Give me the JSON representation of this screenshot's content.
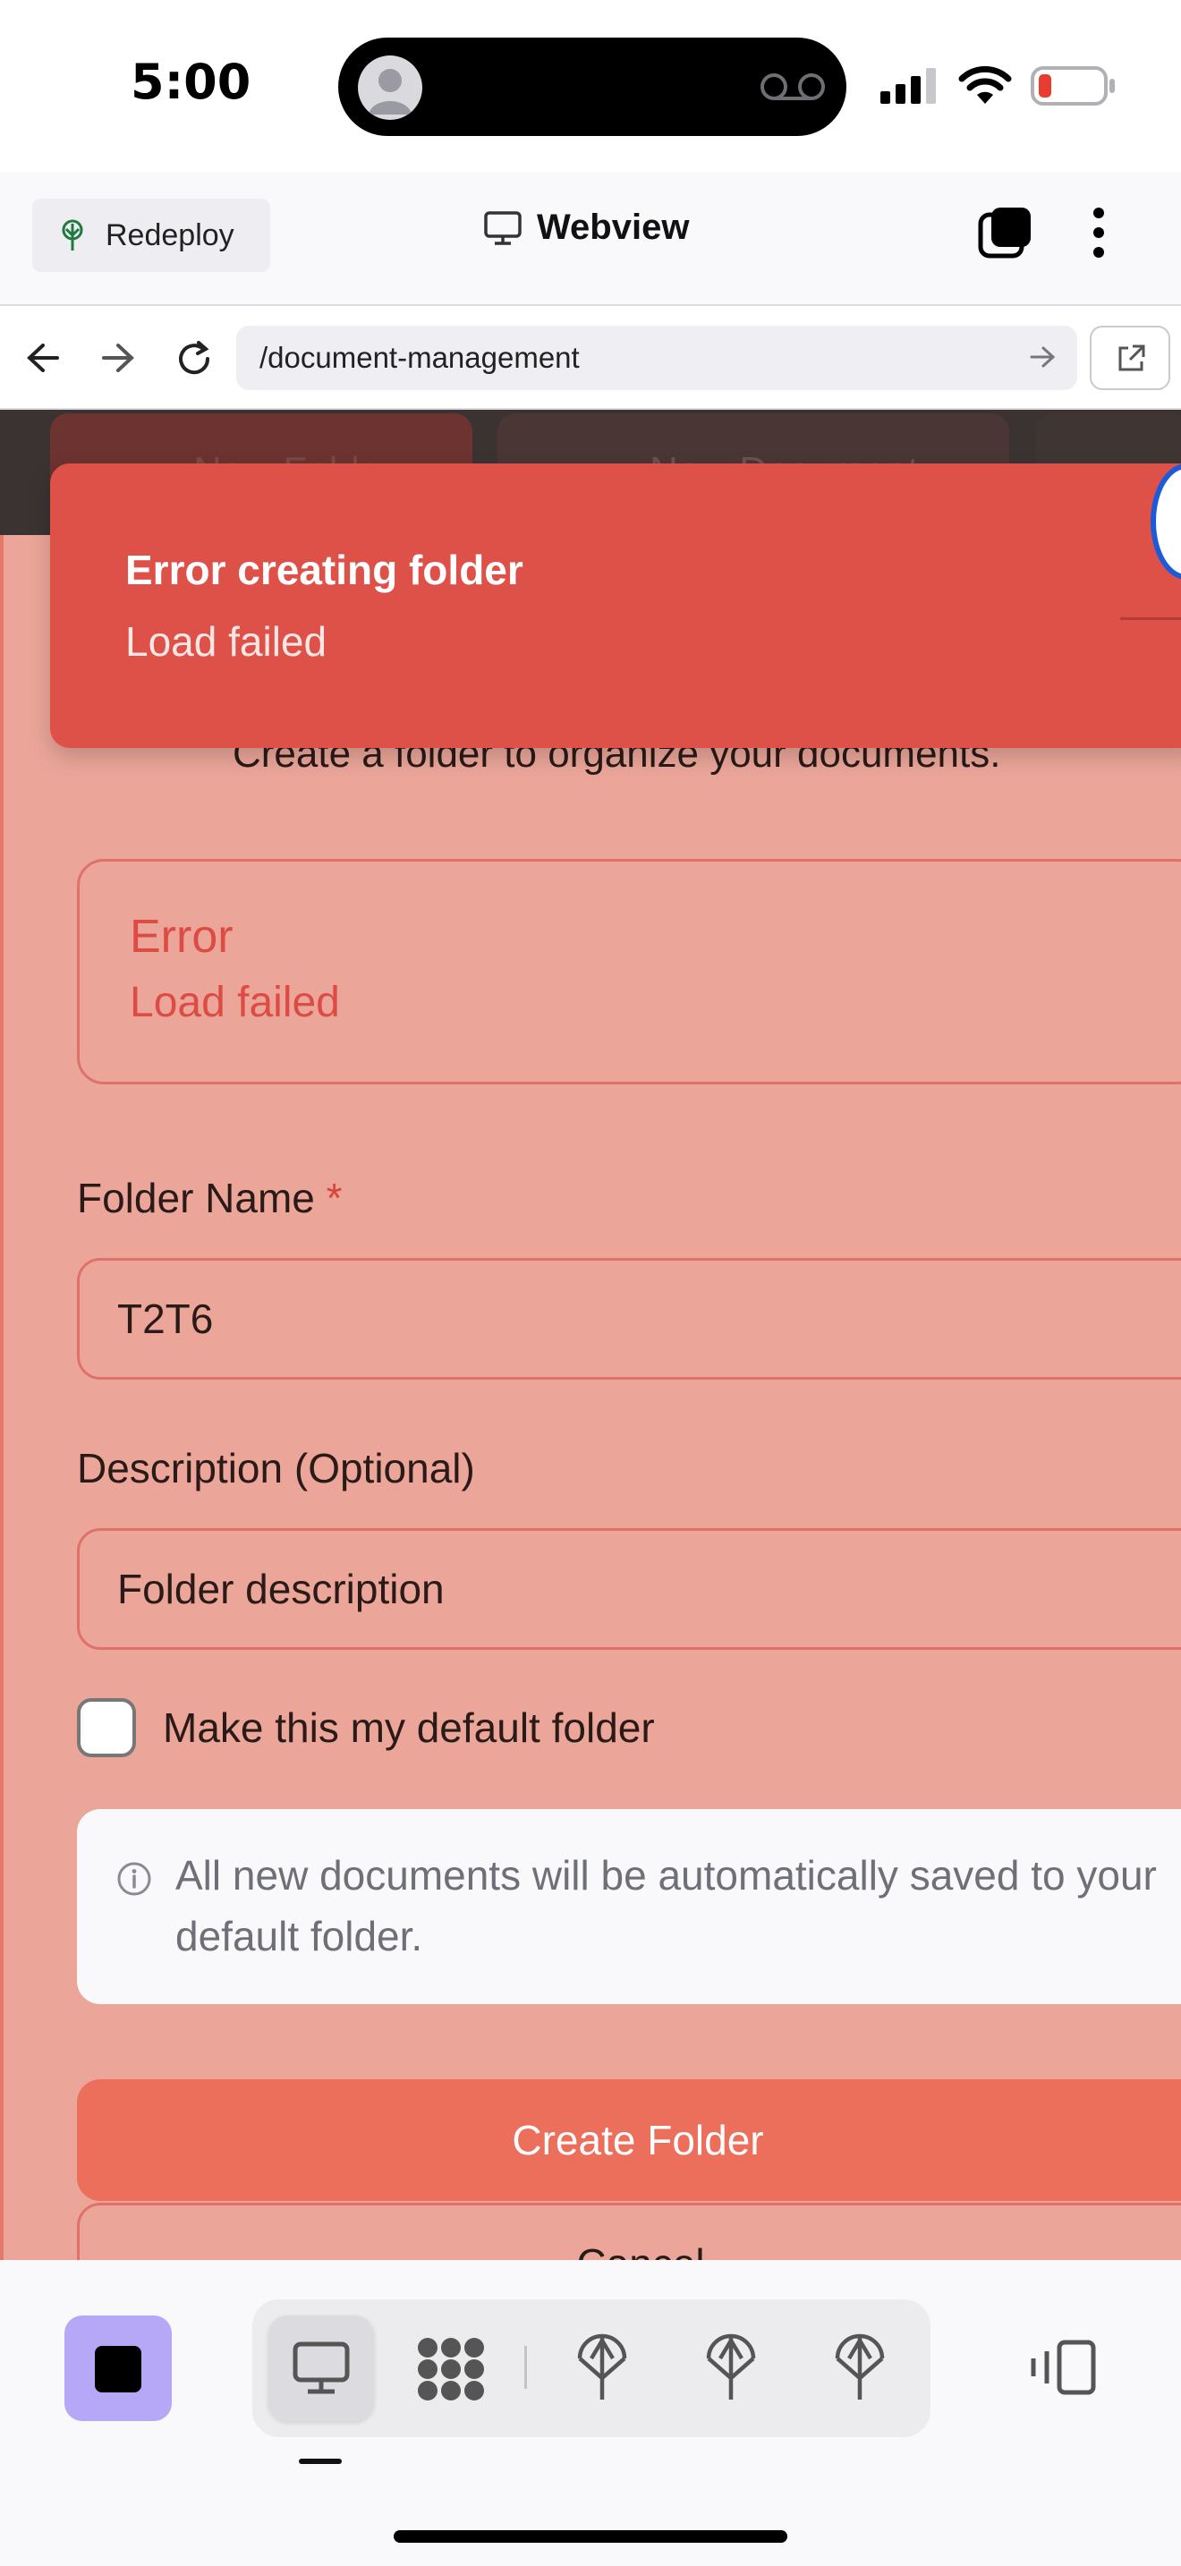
{
  "status_bar": {
    "time": "5:00"
  },
  "header": {
    "redeploy_label": "Redeploy",
    "title": "Webview"
  },
  "address_bar": {
    "url": "/document-management"
  },
  "page": {
    "toolbar_buttons": [
      "New Folder",
      "New Document"
    ],
    "subtitle": "Create a folder to organize your documents."
  },
  "toast": {
    "title": "Error creating folder",
    "message": "Load failed"
  },
  "form": {
    "error_title": "Error",
    "error_message": "Load failed",
    "folder_name_label": "Folder Name",
    "required_mark": "*",
    "folder_name_value": "T2T6",
    "description_label": "Description (Optional)",
    "description_placeholder": "Folder description",
    "default_checkbox_label": "Make this my default folder",
    "default_checked": false,
    "info_text": "All new documents will be automatically saved to your default folder.",
    "create_label": "Create Folder",
    "cancel_label": "Cancel"
  },
  "colors": {
    "toast_bg": "#dd5149",
    "error_text": "#dd4b45",
    "primary_button": "#ec6f5c",
    "app_icon_bg": "#b7a7f7"
  },
  "icons": {
    "header": [
      "tree-icon",
      "monitor-icon",
      "tabs-icon",
      "more-icon"
    ],
    "address": [
      "back-icon",
      "forward-icon",
      "reload-icon",
      "go-icon",
      "external-link-icon"
    ],
    "bottom": [
      "stop-icon",
      "monitor-icon",
      "expo-icon",
      "tree-icon",
      "tree-icon",
      "tree-icon",
      "device-rotate-icon"
    ]
  }
}
